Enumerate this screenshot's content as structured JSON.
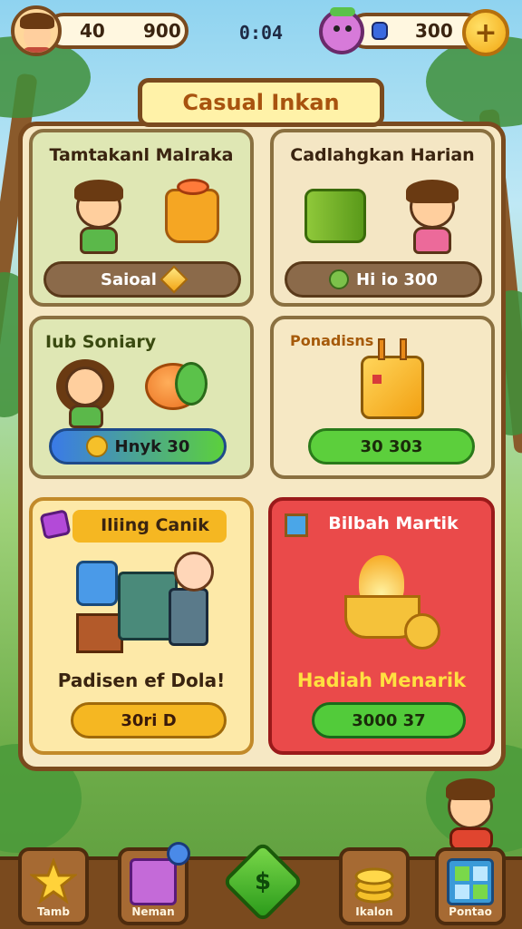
{
  "header": {
    "left_value": "40",
    "left_value_2": "900",
    "timer": "0:04",
    "right_value": "300",
    "add_symbol": "+"
  },
  "title": "Casual Inkan",
  "cards": [
    {
      "title": "Tamtakanl Malraka",
      "button": "Saioal",
      "color": "#dfe7b4",
      "button_color": "#8b6a4a"
    },
    {
      "title": "Cadlahgkan Harian",
      "button": "Hi io 300",
      "color": "#f4e6c4",
      "button_color": "#8b6a4a"
    },
    {
      "title": "Iub Soniary",
      "button": "Hnyk 30",
      "color": "#dfe7b4",
      "button_color": "#4fa4ea"
    },
    {
      "title": "Ponadisns",
      "button": "30 303",
      "color": "#f6e8c4",
      "button_color": "#5ccf3c"
    },
    {
      "title": "Iliing Canik",
      "subtitle": "Padisen ef Dola!",
      "button": "30ri D",
      "color": "#fde9a8",
      "button_color": "#f5b722"
    },
    {
      "title": "Bilbah Martik",
      "subtitle": "Hadiah Menarik",
      "button": "3000 37",
      "color": "#ea4a4a",
      "button_color": "#52cb3a"
    }
  ],
  "nav": [
    {
      "label": "Tamb",
      "icon": "star-icon"
    },
    {
      "label": "Neman",
      "icon": "card-icon"
    },
    {
      "label": "",
      "icon": "dollar-gem-icon"
    },
    {
      "label": "Ikalon",
      "icon": "coins-icon"
    },
    {
      "label": "Pontao",
      "icon": "grid-icon"
    }
  ],
  "colors": {
    "frame": "#7a4a1e",
    "board": "#f6e8c4",
    "accent_gold": "#f3a712"
  }
}
